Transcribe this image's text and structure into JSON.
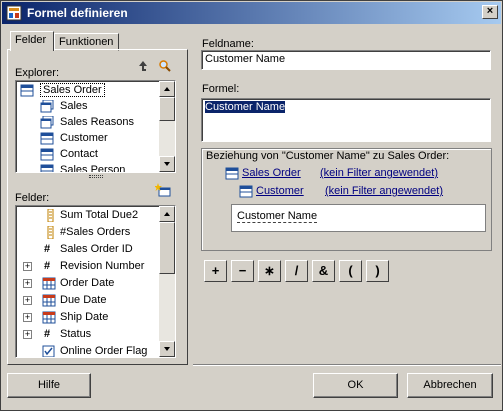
{
  "window": {
    "title": "Formel definieren",
    "close_glyph": "×"
  },
  "tabs": [
    {
      "label": "Felder"
    },
    {
      "label": "Funktionen"
    }
  ],
  "explorer": {
    "label": "Explorer:",
    "items": [
      {
        "label": "Sales Order",
        "icon": "table-icon",
        "selected": true
      },
      {
        "label": "Sales",
        "icon": "table-stack-icon"
      },
      {
        "label": "Sales Reasons",
        "icon": "table-stack-icon"
      },
      {
        "label": "Customer",
        "icon": "table-icon"
      },
      {
        "label": "Contact",
        "icon": "table-icon"
      },
      {
        "label": "Sales Person",
        "icon": "table-icon"
      }
    ]
  },
  "fields": {
    "label": "Felder:",
    "items": [
      {
        "label": "Sum Total Due2",
        "icon": "sum-icon",
        "expand": ""
      },
      {
        "label": "#Sales Orders",
        "icon": "sum-icon",
        "expand": ""
      },
      {
        "label": "Sales Order ID",
        "icon": "hash-icon",
        "expand": ""
      },
      {
        "label": "Revision Number",
        "icon": "hash-icon",
        "expand": "+"
      },
      {
        "label": "Order Date",
        "icon": "calendar-icon",
        "expand": "+"
      },
      {
        "label": "Due Date",
        "icon": "calendar-icon",
        "expand": "+"
      },
      {
        "label": "Ship Date",
        "icon": "calendar-icon",
        "expand": "+"
      },
      {
        "label": "Status",
        "icon": "hash-icon",
        "expand": "+"
      },
      {
        "label": "Online Order Flag",
        "icon": "checkbox-icon",
        "expand": ""
      }
    ]
  },
  "feldname": {
    "label": "Feldname:",
    "value": "Customer Name"
  },
  "formel": {
    "label": "Formel:",
    "value": "Customer Name"
  },
  "relation": {
    "caption": "Beziehung von \"Customer Name\" zu Sales Order:",
    "row1_entity": "Sales Order",
    "row1_filter": "(kein Filter angewendet)",
    "row2_entity": "Customer",
    "row2_filter": "(kein Filter angewendet)",
    "field": "Customer Name"
  },
  "operators": [
    "+",
    "−",
    "∗",
    "/",
    "&",
    "(",
    ")"
  ],
  "buttons": {
    "help": "Hilfe",
    "ok": "OK",
    "cancel": "Abbrechen"
  },
  "colors": {
    "title_start": "#0a246a",
    "title_end": "#a6caf0",
    "selection": "#0a246a"
  }
}
